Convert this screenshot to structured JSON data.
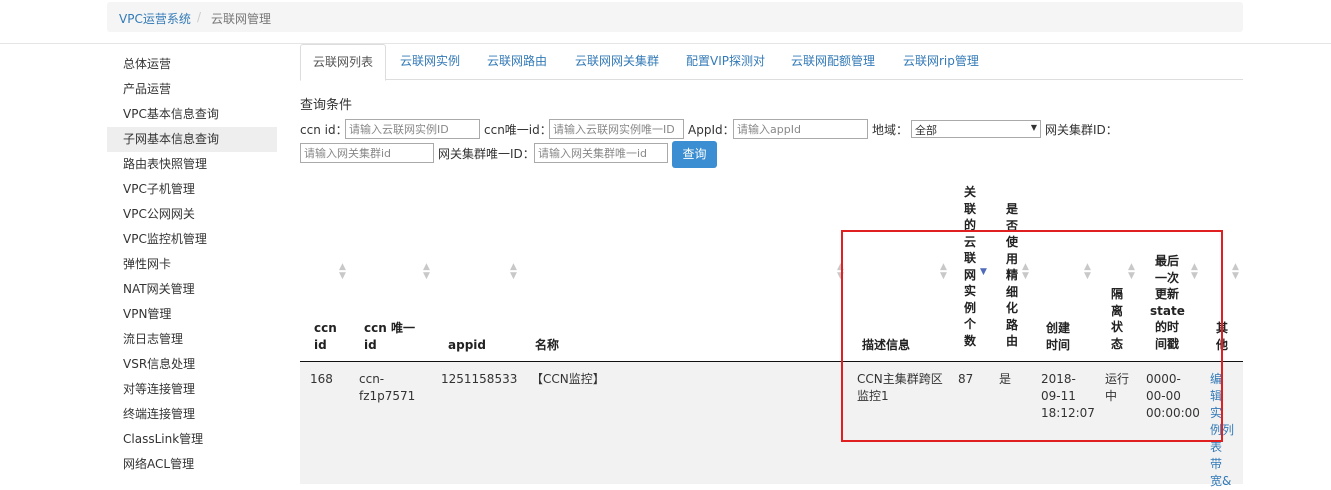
{
  "breadcrumb": {
    "root": "VPC运营系统",
    "sep": "/",
    "current": "云联网管理"
  },
  "sidebar": {
    "items": [
      {
        "label": "总体运营"
      },
      {
        "label": "产品运营"
      },
      {
        "label": "VPC基本信息查询"
      },
      {
        "label": "子网基本信息查询"
      },
      {
        "label": "路由表快照管理"
      },
      {
        "label": "VPC子机管理"
      },
      {
        "label": "VPC公网网关"
      },
      {
        "label": "VPC监控机管理"
      },
      {
        "label": "弹性网卡"
      },
      {
        "label": "NAT网关管理"
      },
      {
        "label": "VPN管理"
      },
      {
        "label": "流日志管理"
      },
      {
        "label": "VSR信息处理"
      },
      {
        "label": "对等连接管理"
      },
      {
        "label": "终端连接管理"
      },
      {
        "label": "ClassLink管理"
      },
      {
        "label": "网络ACL管理"
      }
    ],
    "active_index": 3
  },
  "tabs": [
    {
      "label": "云联网列表"
    },
    {
      "label": "云联网实例"
    },
    {
      "label": "云联网路由"
    },
    {
      "label": "云联网网关集群"
    },
    {
      "label": "配置VIP探测对"
    },
    {
      "label": "云联网配额管理"
    },
    {
      "label": "云联网rip管理"
    }
  ],
  "query": {
    "title": "查询条件",
    "ccn_id_label": "ccn id：",
    "ccn_id_placeholder": "请输入云联网实例ID",
    "ccn_uid_label": "ccn唯一id：",
    "ccn_uid_placeholder": "请输入云联网实例唯一ID",
    "appid_label": "AppId：",
    "appid_placeholder": "请输入appId",
    "region_label": "地域：",
    "region_value": "全部",
    "gw_cluster_label": "网关集群ID：",
    "gw_cluster_placeholder": "请输入网关集群id",
    "gw_cluster_uid_label": "网关集群唯一ID：",
    "gw_cluster_uid_placeholder": "请输入网关集群唯一id",
    "search_button": "查询"
  },
  "table": {
    "headers": [
      {
        "l1": "ccn",
        "l2": "id"
      },
      {
        "l1": "ccn 唯一",
        "l2": "id"
      },
      {
        "l1": "appid"
      },
      {
        "l1": "名称"
      },
      {
        "l1": "描述信息"
      },
      {
        "chars": [
          "关",
          "联",
          "的",
          "云",
          "联",
          "网",
          "实",
          "例",
          "个",
          "数"
        ]
      },
      {
        "chars": [
          "是",
          "否",
          "使",
          "用",
          "精",
          "细",
          "化",
          "路",
          "由"
        ]
      },
      {
        "l1": "创建",
        "l2": "时间"
      },
      {
        "chars": [
          "隔",
          "离",
          "状",
          "态"
        ]
      },
      {
        "lines": [
          "最后",
          "一次",
          "更新",
          "state",
          "的时",
          "间戳"
        ]
      },
      {
        "chars": [
          "其",
          "他"
        ]
      }
    ],
    "row": {
      "ccn_id": "168",
      "ccn_uid": [
        "ccn-",
        "fz1p7571"
      ],
      "appid": "1251158533",
      "name": "【CCN监控】",
      "desc": [
        "CCN主集群跨区",
        "监控1"
      ],
      "instance_count": "87",
      "fine_route": "是",
      "created": [
        "2018-",
        "09-11",
        "18:12:07"
      ],
      "isolation": [
        "运行",
        "中"
      ],
      "updated": [
        "0000-",
        "00-00",
        "00:00:00"
      ],
      "other_links": [
        "编",
        "辑",
        "实",
        "例列",
        "表",
        "带",
        "宽&"
      ]
    }
  },
  "colors": {
    "link": "#337ab7",
    "button": "#3a8ed1",
    "highlight_box": "#e02020"
  }
}
